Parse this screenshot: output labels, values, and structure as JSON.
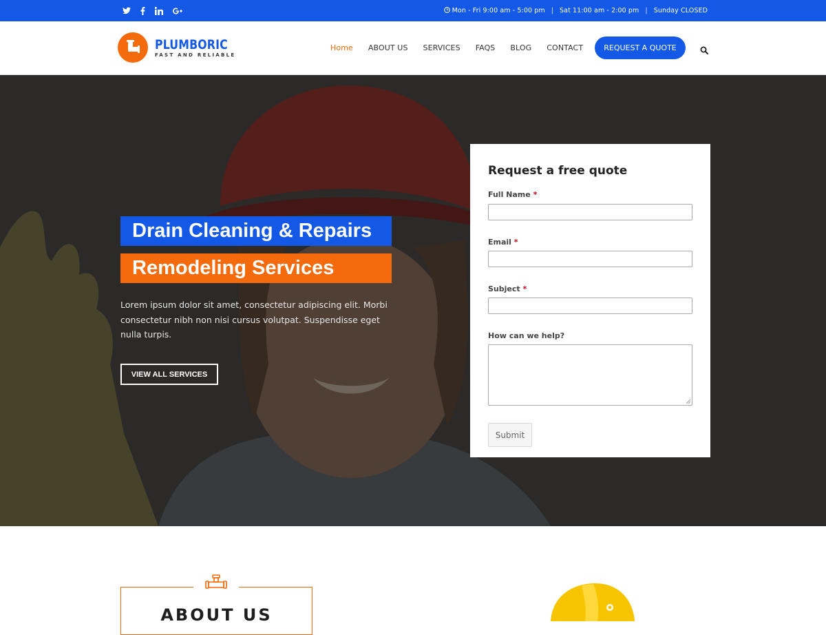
{
  "topbar": {
    "social": [
      "twitter-icon",
      "facebook-icon",
      "linkedin-icon",
      "google-plus-icon"
    ],
    "hours": [
      "Mon - Fri 9:00 am - 5:00 pm",
      "Sat 11:00 am - 2:00 pm",
      "Sunday CLOSED"
    ],
    "separator": "|"
  },
  "logo": {
    "name": "PLUMBORIC",
    "tagline": "FAST AND RELIABLE"
  },
  "nav": {
    "items": [
      "Home",
      "ABOUT US",
      "SERVICES",
      "FAQS",
      "BLOG",
      "CONTACT"
    ],
    "cta": "REQUEST A QUOTE",
    "active": "Home"
  },
  "hero": {
    "headline1": "Drain Cleaning & Repairs",
    "headline2": "Remodeling Services",
    "text": "Lorem ipsum dolor sit amet, consectetur adipiscing elit. Morbi consectetur nibh non nisi cursus volutpat. Suspendisse eget nulla turpis.",
    "button": "VIEW ALL SERVICES"
  },
  "form": {
    "title": "Request a free quote",
    "full_name": "Full Name",
    "email": "Email",
    "subject": "Subject",
    "help": "How can we help?",
    "required_mark": "*",
    "submit": "Submit"
  },
  "about": {
    "title": "ABOUT US"
  },
  "colors": {
    "blue": "#1459e6",
    "orange": "#f36b0d",
    "dark": "#2f2e2d"
  }
}
